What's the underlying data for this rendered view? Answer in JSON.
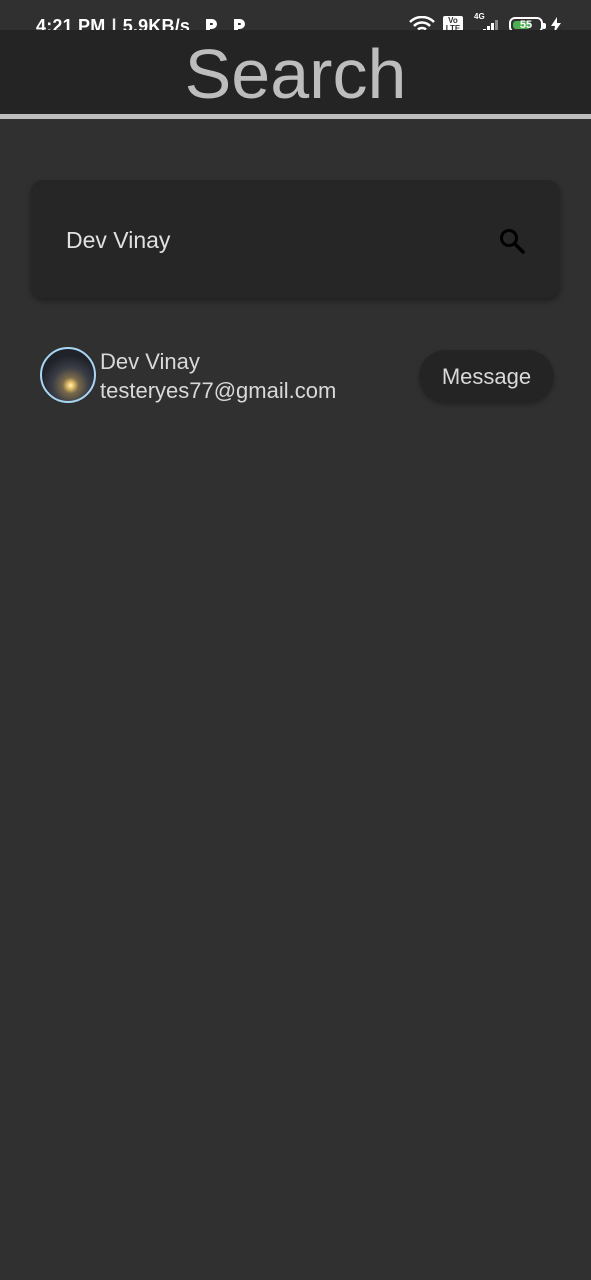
{
  "status_bar": {
    "time": "4:21 PM",
    "separator": "|",
    "net_speed": "5.9KB/s",
    "volte_label": "Vo LTE",
    "network_type": "4G",
    "battery_level": "55",
    "icons": [
      "p-notification-icon",
      "p-notification-icon",
      "wifi-icon",
      "volte-icon",
      "signal-icon",
      "battery-icon",
      "charging-bolt-icon"
    ]
  },
  "app_bar": {
    "title": "Search"
  },
  "search": {
    "value": "Dev Vinay",
    "placeholder": "",
    "icon": "search-icon"
  },
  "results": [
    {
      "name": "Dev Vinay",
      "email": "testeryes77@gmail.com",
      "action_label": "Message"
    }
  ],
  "colors": {
    "background": "#303030",
    "app_bar": "#242424",
    "title_text": "#bdbdbd",
    "search_box": "#262626",
    "avatar_border": "#a9d6f5",
    "battery_fill": "#4caf50"
  }
}
